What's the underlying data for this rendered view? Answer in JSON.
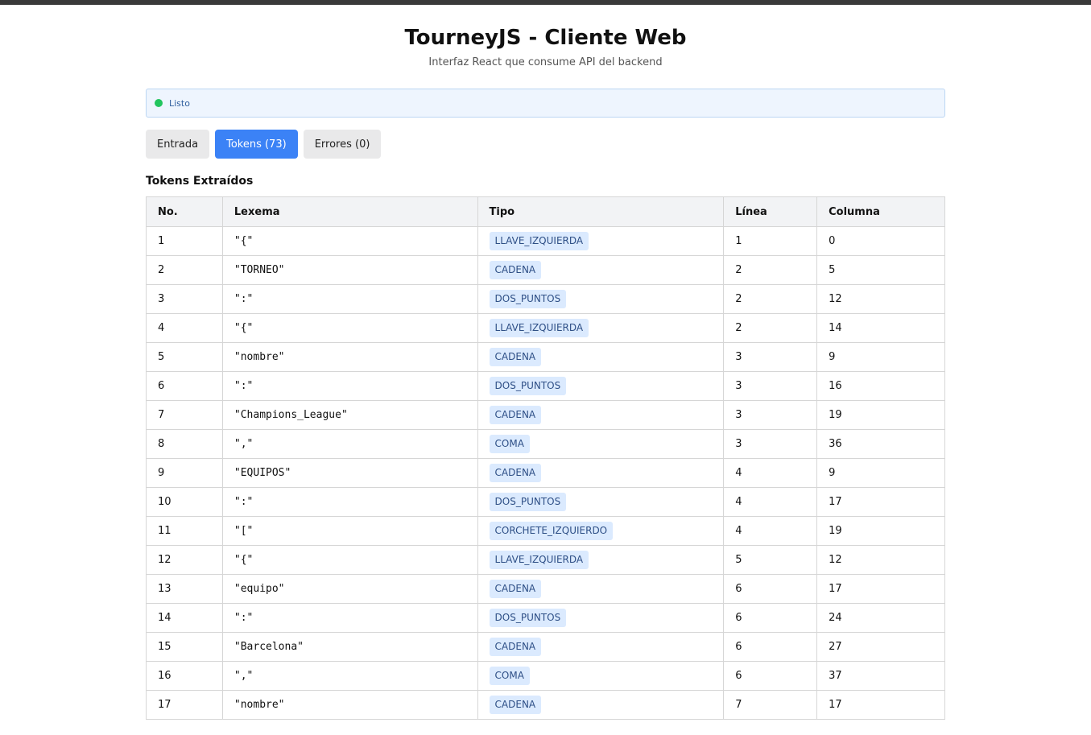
{
  "header": {
    "title": "TourneyJS - Cliente Web",
    "subtitle": "Interfaz React que consume API del backend"
  },
  "status": {
    "text": "Listo",
    "color": "#22c55e"
  },
  "tabs": [
    {
      "label": "Entrada",
      "active": false
    },
    {
      "label": "Tokens (73)",
      "active": true
    },
    {
      "label": "Errores (0)",
      "active": false
    }
  ],
  "section": {
    "title": "Tokens Extraídos"
  },
  "table": {
    "columns": [
      "No.",
      "Lexema",
      "Tipo",
      "Línea",
      "Columna"
    ],
    "rows": [
      {
        "no": "1",
        "lexema": "\"{\"",
        "tipo": "LLAVE_IZQUIERDA",
        "linea": "1",
        "columna": "0"
      },
      {
        "no": "2",
        "lexema": "\"TORNEO\"",
        "tipo": "CADENA",
        "linea": "2",
        "columna": "5"
      },
      {
        "no": "3",
        "lexema": "\":\"",
        "tipo": "DOS_PUNTOS",
        "linea": "2",
        "columna": "12"
      },
      {
        "no": "4",
        "lexema": "\"{\"",
        "tipo": "LLAVE_IZQUIERDA",
        "linea": "2",
        "columna": "14"
      },
      {
        "no": "5",
        "lexema": "\"nombre\"",
        "tipo": "CADENA",
        "linea": "3",
        "columna": "9"
      },
      {
        "no": "6",
        "lexema": "\":\"",
        "tipo": "DOS_PUNTOS",
        "linea": "3",
        "columna": "16"
      },
      {
        "no": "7",
        "lexema": "\"Champions_League\"",
        "tipo": "CADENA",
        "linea": "3",
        "columna": "19"
      },
      {
        "no": "8",
        "lexema": "\",\"",
        "tipo": "COMA",
        "linea": "3",
        "columna": "36"
      },
      {
        "no": "9",
        "lexema": "\"EQUIPOS\"",
        "tipo": "CADENA",
        "linea": "4",
        "columna": "9"
      },
      {
        "no": "10",
        "lexema": "\":\"",
        "tipo": "DOS_PUNTOS",
        "linea": "4",
        "columna": "17"
      },
      {
        "no": "11",
        "lexema": "\"[\"",
        "tipo": "CORCHETE_IZQUIERDO",
        "linea": "4",
        "columna": "19"
      },
      {
        "no": "12",
        "lexema": "\"{\"",
        "tipo": "LLAVE_IZQUIERDA",
        "linea": "5",
        "columna": "12"
      },
      {
        "no": "13",
        "lexema": "\"equipo\"",
        "tipo": "CADENA",
        "linea": "6",
        "columna": "17"
      },
      {
        "no": "14",
        "lexema": "\":\"",
        "tipo": "DOS_PUNTOS",
        "linea": "6",
        "columna": "24"
      },
      {
        "no": "15",
        "lexema": "\"Barcelona\"",
        "tipo": "CADENA",
        "linea": "6",
        "columna": "27"
      },
      {
        "no": "16",
        "lexema": "\",\"",
        "tipo": "COMA",
        "linea": "6",
        "columna": "37"
      },
      {
        "no": "17",
        "lexema": "\"nombre\"",
        "tipo": "CADENA",
        "linea": "7",
        "columna": "17"
      }
    ]
  },
  "colors": {
    "accent": "#3b82f6",
    "badge_bg": "#dbeafe",
    "badge_text": "#2e4f86"
  }
}
